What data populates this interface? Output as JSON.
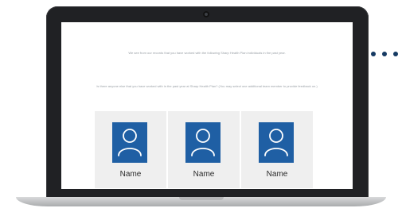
{
  "screen": {
    "intro_text": "We see from our records that you have worked with the following Sharp Health Plan individuals in the past year.",
    "question_text": "Is there anyone else that you have worked with in the past year at Sharp Health Plan? (You may select one additional team member to provide feedback on.)"
  },
  "cards": [
    {
      "label": "Name",
      "icon": "person-icon"
    },
    {
      "label": "Name",
      "icon": "person-icon"
    },
    {
      "label": "Name",
      "icon": "person-icon"
    }
  ],
  "colors": {
    "avatar_background": "#1f5fa4",
    "card_background": "#efefef",
    "pagination_dots": "#163a63"
  },
  "pagination": {
    "icon": "more-dots-icon",
    "count": 3
  }
}
